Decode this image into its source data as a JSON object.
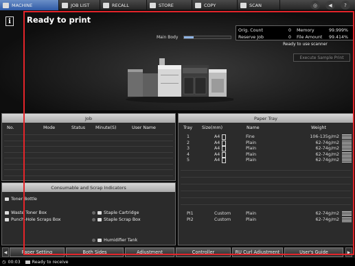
{
  "top_tabs": [
    {
      "label": "MACHINE",
      "icon": "machine-icon"
    },
    {
      "label": "JOB LIST",
      "icon": "job-list-icon"
    },
    {
      "label": "RECALL",
      "icon": "recall-icon"
    },
    {
      "label": "STORE",
      "icon": "store-icon"
    },
    {
      "label": "COPY",
      "icon": "copy-icon"
    },
    {
      "label": "SCAN",
      "icon": "scan-icon"
    }
  ],
  "top_buttons": [
    {
      "glyph": "◎",
      "icon": "web-browser-icon"
    },
    {
      "glyph": "◀",
      "icon": "volume-icon"
    },
    {
      "glyph": "?",
      "icon": "help-icon"
    }
  ],
  "status": {
    "message": "Ready to print",
    "main_body_label": "Main Body",
    "main_body_level": 0.2,
    "counter": {
      "orig_count_label": "Orig. Count",
      "orig_count": "0",
      "memory_label": "Memory",
      "memory": "99.999%",
      "reserve_job_label": "Reserve Job",
      "reserve_job": "0",
      "file_amount_label": "File Amount",
      "file_amount": "99.414%"
    },
    "scanner_status": "Ready to use scanner",
    "execute_sample_print": "Execute Sample Print"
  },
  "job_panel": {
    "title": "Job",
    "columns": [
      "No.",
      "Mode",
      "Status",
      "Minute(S)",
      "User Name"
    ]
  },
  "consumable_panel": {
    "title": "Consumable and Scrap Indicators",
    "items": [
      {
        "label": "Toner Bottle",
        "icon": "toner-bottle-icon"
      },
      {
        "label": "Waste Toner Box",
        "icon": "waste-toner-icon"
      },
      {
        "label": "Punch-Hole Scraps Box",
        "icon": "punch-hole-icon"
      },
      {
        "label": "Staple Cartridge",
        "icon": "staple-cartridge-icon"
      },
      {
        "label": "Staple Scrap Box",
        "icon": "staple-scrap-icon"
      },
      {
        "label": "Humidifier Tank",
        "icon": "humidifier-tank-icon"
      }
    ]
  },
  "tray_panel": {
    "title": "Paper Tray",
    "columns": [
      "Tray",
      "Size(mm)",
      "Name",
      "Weight"
    ],
    "rows": [
      {
        "tray": "1",
        "size": "A4",
        "name": "Fine",
        "weight": "106-135g/m2"
      },
      {
        "tray": "2",
        "size": "A4",
        "name": "Plain",
        "weight": "62-74g/m2"
      },
      {
        "tray": "3",
        "size": "A4",
        "name": "Plain",
        "weight": "62-74g/m2"
      },
      {
        "tray": "4",
        "size": "A4",
        "name": "Plain",
        "weight": "62-74g/m2"
      },
      {
        "tray": "5",
        "size": "A4",
        "name": "Plain",
        "weight": "62-74g/m2"
      }
    ],
    "pi_rows": [
      {
        "tray": "PI1",
        "size": "Custom",
        "name": "Plain",
        "weight": "62-74g/m2"
      },
      {
        "tray": "PI2",
        "size": "Custom",
        "name": "Plain",
        "weight": "62-74g/m2"
      }
    ]
  },
  "bottom_tabs": [
    "Paper Setting",
    "Both Sides",
    "Adjustment",
    "Controller",
    "RU Curl Adjustment",
    "User's Guide"
  ],
  "footer": {
    "time": "00:03",
    "message": "Ready to receive"
  },
  "colors": {
    "active_tab": "#2f5aa6",
    "highlight_frame": "#e5242a"
  }
}
